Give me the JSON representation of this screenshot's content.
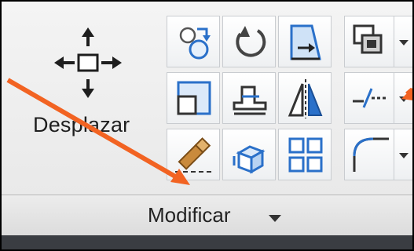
{
  "move_tool": {
    "label": "Desplazar",
    "icon": "move-arrows-icon"
  },
  "tools": [
    {
      "name": "copy-icon"
    },
    {
      "name": "rotate-icon"
    },
    {
      "name": "trim-icon"
    },
    {
      "name": "scale-icon"
    },
    {
      "name": "stretch-icon"
    },
    {
      "name": "mirror-icon"
    },
    {
      "name": "erase-icon"
    },
    {
      "name": "explode-icon"
    },
    {
      "name": "array-icon"
    }
  ],
  "split_tools": [
    {
      "name": "draw-order-icon"
    },
    {
      "name": "break-icon"
    },
    {
      "name": "fillet-icon"
    }
  ],
  "panel": {
    "title": "Modificar"
  },
  "colors": {
    "accent": "#f26322",
    "icon_blue": "#2a70c9"
  }
}
